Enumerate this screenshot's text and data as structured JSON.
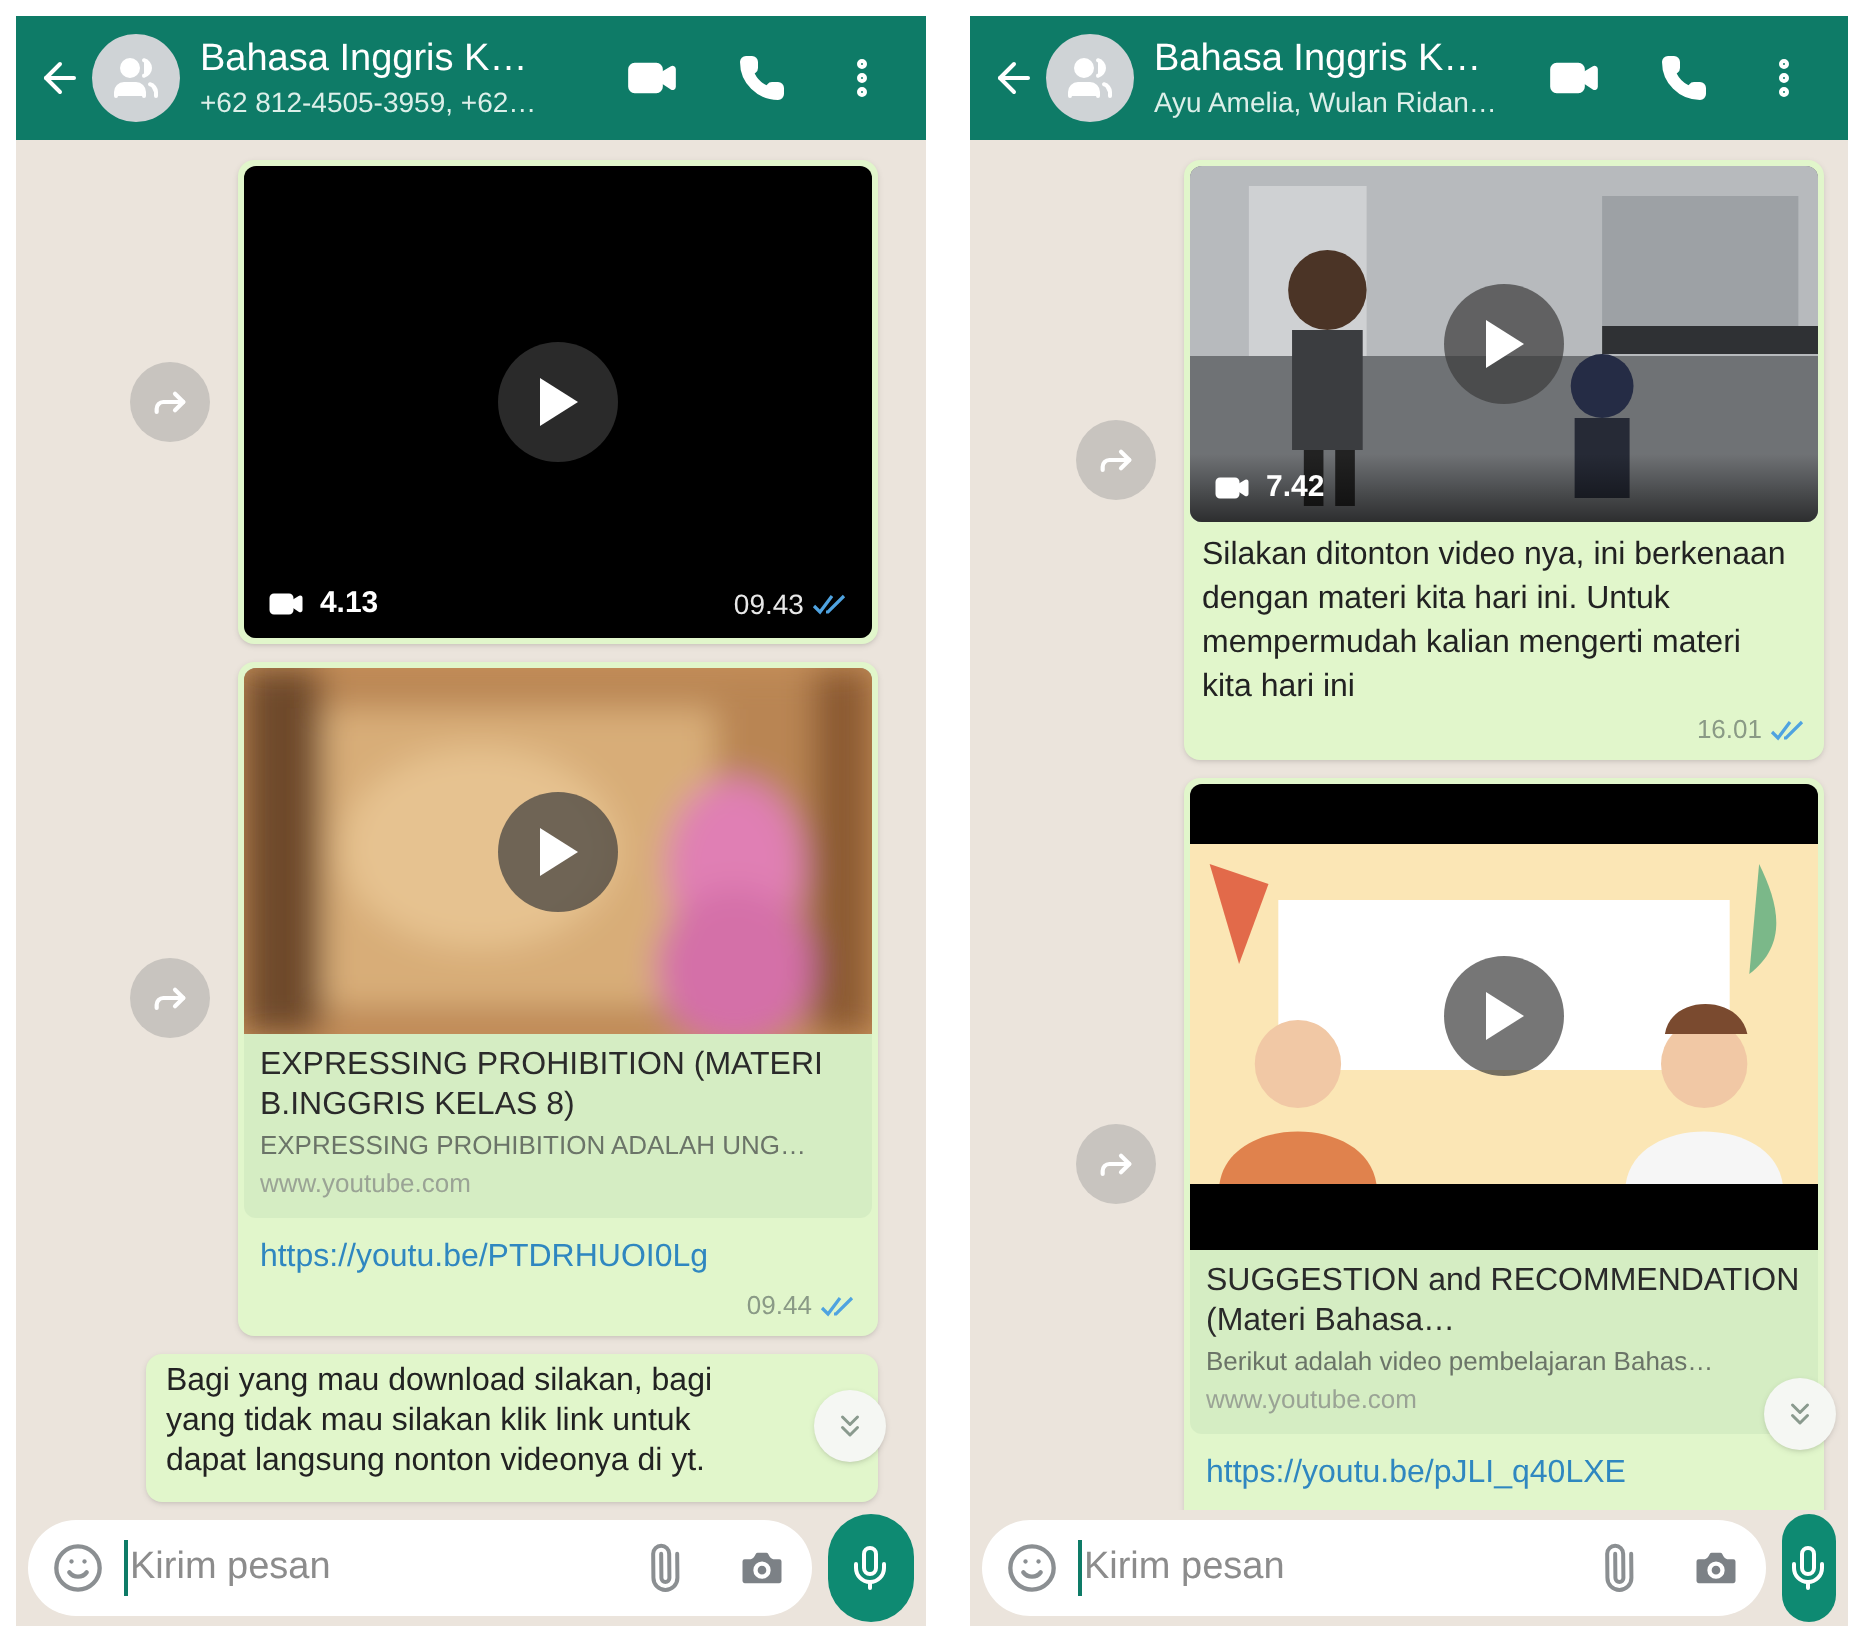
{
  "panels": [
    {
      "header": {
        "title": "Bahasa Inggris K…",
        "subtitle": "+62 812-4505-3959, +62…"
      },
      "messages": [
        {
          "kind": "video",
          "duration": "4.13",
          "time": "09.43",
          "read": true
        },
        {
          "kind": "link_preview",
          "title": "EXPRESSING PROHIBITION (MATERI B.INGGRIS KELAS 8)",
          "description": "EXPRESSING PROHIBITION ADALAH UNG…",
          "domain": "www.youtube.com",
          "link": "https://youtu.be/PTDRHUOI0Lg",
          "time": "09.44",
          "read": true
        },
        {
          "kind": "text",
          "text": "Bagi yang mau download silakan, bagi yang tidak mau silakan klik link untuk dapat langsung nonton videonya di yt."
        }
      ],
      "input": {
        "placeholder": "Kirim pesan"
      }
    },
    {
      "header": {
        "title": "Bahasa Inggris K…",
        "subtitle": "Ayu Amelia, Wulan Ridan…"
      },
      "messages": [
        {
          "kind": "video",
          "duration": "7.42",
          "caption": "Silakan ditonton video nya, ini berkenaan dengan materi kita hari ini. Untuk mempermudah kalian mengerti materi kita hari ini",
          "time": "16.01",
          "read": true
        },
        {
          "kind": "link_preview",
          "title": "SUGGESTION and RECOMMENDATION (Materi Bahasa…",
          "description": "Berikut adalah video pembelajaran Bahas…",
          "domain": "www.youtube.com",
          "link": "https://youtu.be/pJLI_q40LXE"
        }
      ],
      "input": {
        "placeholder": "Kirim pesan"
      }
    }
  ]
}
